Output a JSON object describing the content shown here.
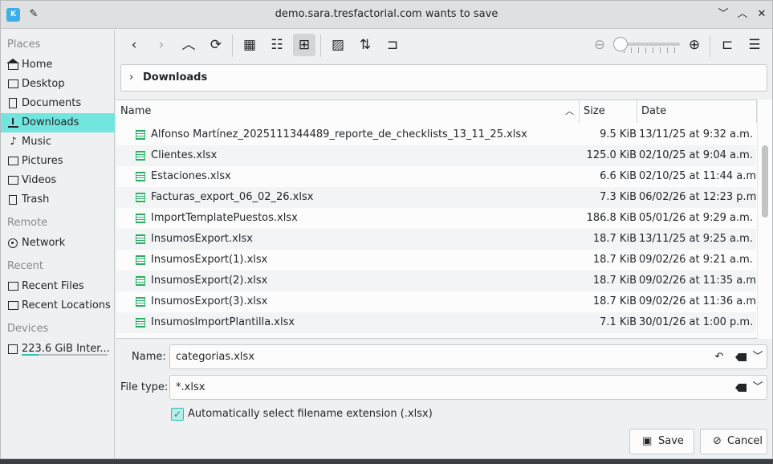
{
  "window": {
    "title": "demo.sara.tresfactorial.com wants to save",
    "app_icon": "kde-icon",
    "controls": [
      "chevron-down-icon",
      "chevron-up-icon",
      "close-icon"
    ]
  },
  "sidebar": {
    "sections": [
      {
        "header": "Places",
        "items": [
          {
            "label": "Home",
            "icon": "home-icon"
          },
          {
            "label": "Desktop",
            "icon": "desktop-icon"
          },
          {
            "label": "Documents",
            "icon": "documents-icon"
          },
          {
            "label": "Downloads",
            "icon": "downloads-icon",
            "active": true
          },
          {
            "label": "Music",
            "icon": "music-icon"
          },
          {
            "label": "Pictures",
            "icon": "pictures-icon"
          },
          {
            "label": "Videos",
            "icon": "videos-icon"
          },
          {
            "label": "Trash",
            "icon": "trash-icon"
          }
        ]
      },
      {
        "header": "Remote",
        "items": [
          {
            "label": "Network",
            "icon": "network-icon"
          }
        ]
      },
      {
        "header": "Recent",
        "items": [
          {
            "label": "Recent Files",
            "icon": "recent-files-icon"
          },
          {
            "label": "Recent Locations",
            "icon": "recent-locations-icon"
          }
        ]
      },
      {
        "header": "Devices",
        "items": [
          {
            "label": "223.6 GiB Inter...",
            "icon": "disk-icon",
            "usage_fraction": 0.2
          }
        ]
      }
    ]
  },
  "toolbar": {
    "zoom_level_fraction": 0.0
  },
  "breadcrumb": {
    "current": "Downloads"
  },
  "filelist": {
    "columns": {
      "name": "Name",
      "size": "Size",
      "date": "Date"
    },
    "rows": [
      {
        "name": "Alfonso Martínez_2025111344489_reporte_de_checklists_13_11_25.xlsx",
        "size": "9.5 KiB",
        "date": "13/11/25 at 9:32 a.m."
      },
      {
        "name": "Clientes.xlsx",
        "size": "125.0 KiB",
        "date": "02/10/25 at 9:04 a.m."
      },
      {
        "name": "Estaciones.xlsx",
        "size": "6.6 KiB",
        "date": "02/10/25 at 11:44 a.m."
      },
      {
        "name": "Facturas_export_06_02_26.xlsx",
        "size": "7.3 KiB",
        "date": "06/02/26 at 12:23 p.m."
      },
      {
        "name": "ImportTemplatePuestos.xlsx",
        "size": "186.8 KiB",
        "date": "05/01/26 at 9:29 a.m."
      },
      {
        "name": "InsumosExport.xlsx",
        "size": "18.7 KiB",
        "date": "13/11/25 at 9:25 a.m."
      },
      {
        "name": "InsumosExport(1).xlsx",
        "size": "18.7 KiB",
        "date": "09/02/26 at 9:21 a.m."
      },
      {
        "name": "InsumosExport(2).xlsx",
        "size": "18.7 KiB",
        "date": "09/02/26 at 11:35 a.m."
      },
      {
        "name": "InsumosExport(3).xlsx",
        "size": "18.7 KiB",
        "date": "09/02/26 at 11:36 a.m."
      },
      {
        "name": "InsumosImportPlantilla.xlsx",
        "size": "7.1 KiB",
        "date": "30/01/26 at 1:00 p.m."
      }
    ]
  },
  "form": {
    "name_label": "Name:",
    "name_value": "categorias.xlsx",
    "filetype_label": "File type:",
    "filetype_value": "*.xlsx",
    "auto_ext_label": "Automatically select filename extension (.xlsx)",
    "auto_ext_checked": true
  },
  "buttons": {
    "save": "Save",
    "cancel": "Cancel"
  }
}
